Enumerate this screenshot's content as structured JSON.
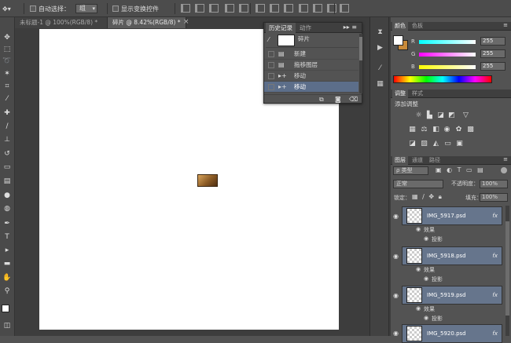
{
  "options_bar": {
    "auto_select_label": "自动选择：",
    "auto_select_value": "组",
    "show_transform_label": "显示变换控件"
  },
  "tabs": [
    {
      "label": "未标题-1 @ 100%(RGB/8) *"
    },
    {
      "label": "碎片 @ 8.42%(RGB/8) *"
    }
  ],
  "history_panel": {
    "tabs": [
      "历史记录",
      "动作"
    ],
    "snapshot_label": "碎片",
    "rows": [
      {
        "label": "新建",
        "icon": "doc-icon"
      },
      {
        "label": "拖移图层",
        "icon": "doc-icon"
      },
      {
        "label": "移动",
        "icon": "move-icon"
      },
      {
        "label": "移动",
        "icon": "move-icon",
        "selected": true
      }
    ]
  },
  "color_panel": {
    "tabs": [
      "颜色",
      "色板"
    ],
    "channels": [
      {
        "label": "R",
        "value": "255",
        "color": "#ff0000"
      },
      {
        "label": "G",
        "value": "255",
        "color": "#00c000"
      },
      {
        "label": "B",
        "value": "255",
        "color": "#0000ff"
      }
    ]
  },
  "adjust_panel": {
    "tabs": [
      "调整",
      "样式"
    ],
    "title": "添加调整"
  },
  "layers_panel": {
    "tabs": [
      "图层",
      "通道",
      "路径"
    ],
    "filter_label": "ρ 类型",
    "blend_mode": "正常",
    "opacity_label": "不透明度：",
    "opacity_value": "100%",
    "lock_label": "锁定：",
    "fill_label": "填充：",
    "fill_value": "100%",
    "effects_label": "效果",
    "shadow_label": "投影",
    "layers": [
      {
        "name": "IMG_5917.psd",
        "fx": "fx"
      },
      {
        "name": "IMG_5918.psd",
        "fx": "fx"
      },
      {
        "name": "IMG_5919.psd",
        "fx": "fx"
      },
      {
        "name": "IMG_5920.psd",
        "fx": "fx"
      }
    ]
  },
  "colors": {
    "selection": "#66758c",
    "canvas": "#ffffff",
    "background_swatch": "#c88a3a"
  }
}
